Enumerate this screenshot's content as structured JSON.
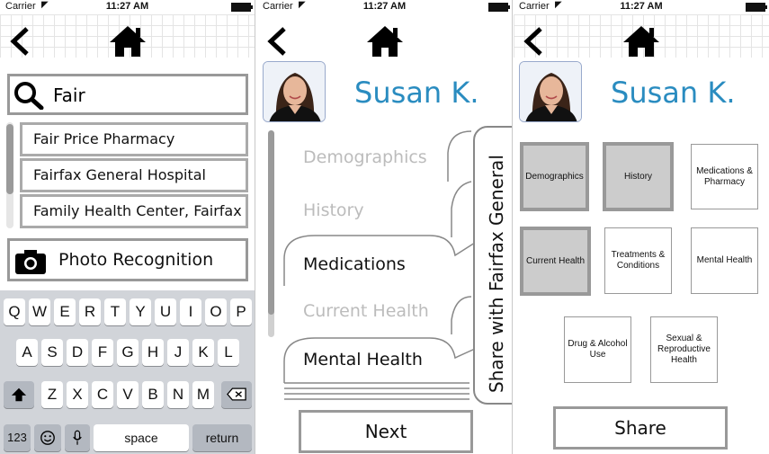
{
  "status_bar": {
    "carrier": "Carrier",
    "time": "11:27 AM"
  },
  "search_screen": {
    "search_value": "Fair",
    "results": [
      "Fair Price Pharmacy",
      "Fairfax General Hospital",
      "Family Health Center, Fairfax"
    ],
    "photo_recognition_label": "Photo Recognition",
    "keyboard": {
      "row1": [
        "Q",
        "W",
        "E",
        "R",
        "T",
        "Y",
        "U",
        "I",
        "O",
        "P"
      ],
      "row2": [
        "A",
        "S",
        "D",
        "F",
        "G",
        "H",
        "J",
        "K",
        "L"
      ],
      "row3": [
        "Z",
        "X",
        "C",
        "V",
        "B",
        "N",
        "M"
      ],
      "numbers_key": "123",
      "space_key": "space",
      "return_key": "return"
    }
  },
  "tabs_screen": {
    "patient_name": "Susan K.",
    "tabs": [
      {
        "label": "Demographics",
        "state": "inactive"
      },
      {
        "label": "History",
        "state": "inactive"
      },
      {
        "label": "Medications",
        "state": "active"
      },
      {
        "label": "Current Health",
        "state": "inactive"
      },
      {
        "label": "Mental Health",
        "state": "active"
      }
    ],
    "share_tab_label": "Share with Fairfax General",
    "next_button": "Next"
  },
  "grid_screen": {
    "patient_name": "Susan K.",
    "tiles": [
      {
        "label": "Demographics",
        "selected": true
      },
      {
        "label": "History",
        "selected": true
      },
      {
        "label": "Medications & Pharmacy",
        "selected": false
      },
      {
        "label": "Current Health",
        "selected": true
      },
      {
        "label": "Treatments & Conditions",
        "selected": false
      },
      {
        "label": "Mental Health",
        "selected": false
      },
      {
        "label": "Drug & Alcohol Use",
        "selected": false
      },
      {
        "label": "Sexual & Reproductive Health",
        "selected": false
      }
    ],
    "share_button": "Share"
  },
  "colors": {
    "name_blue": "#2a8cc0",
    "selected_tile": "#cccccc",
    "border_gray": "#999999",
    "keyboard_bg": "#d1d4d9"
  },
  "icons": [
    "back-chevron-icon",
    "home-icon",
    "search-icon",
    "camera-icon",
    "shift-icon",
    "delete-icon",
    "emoji-icon",
    "microphone-icon",
    "wifi-icon",
    "battery-icon"
  ]
}
